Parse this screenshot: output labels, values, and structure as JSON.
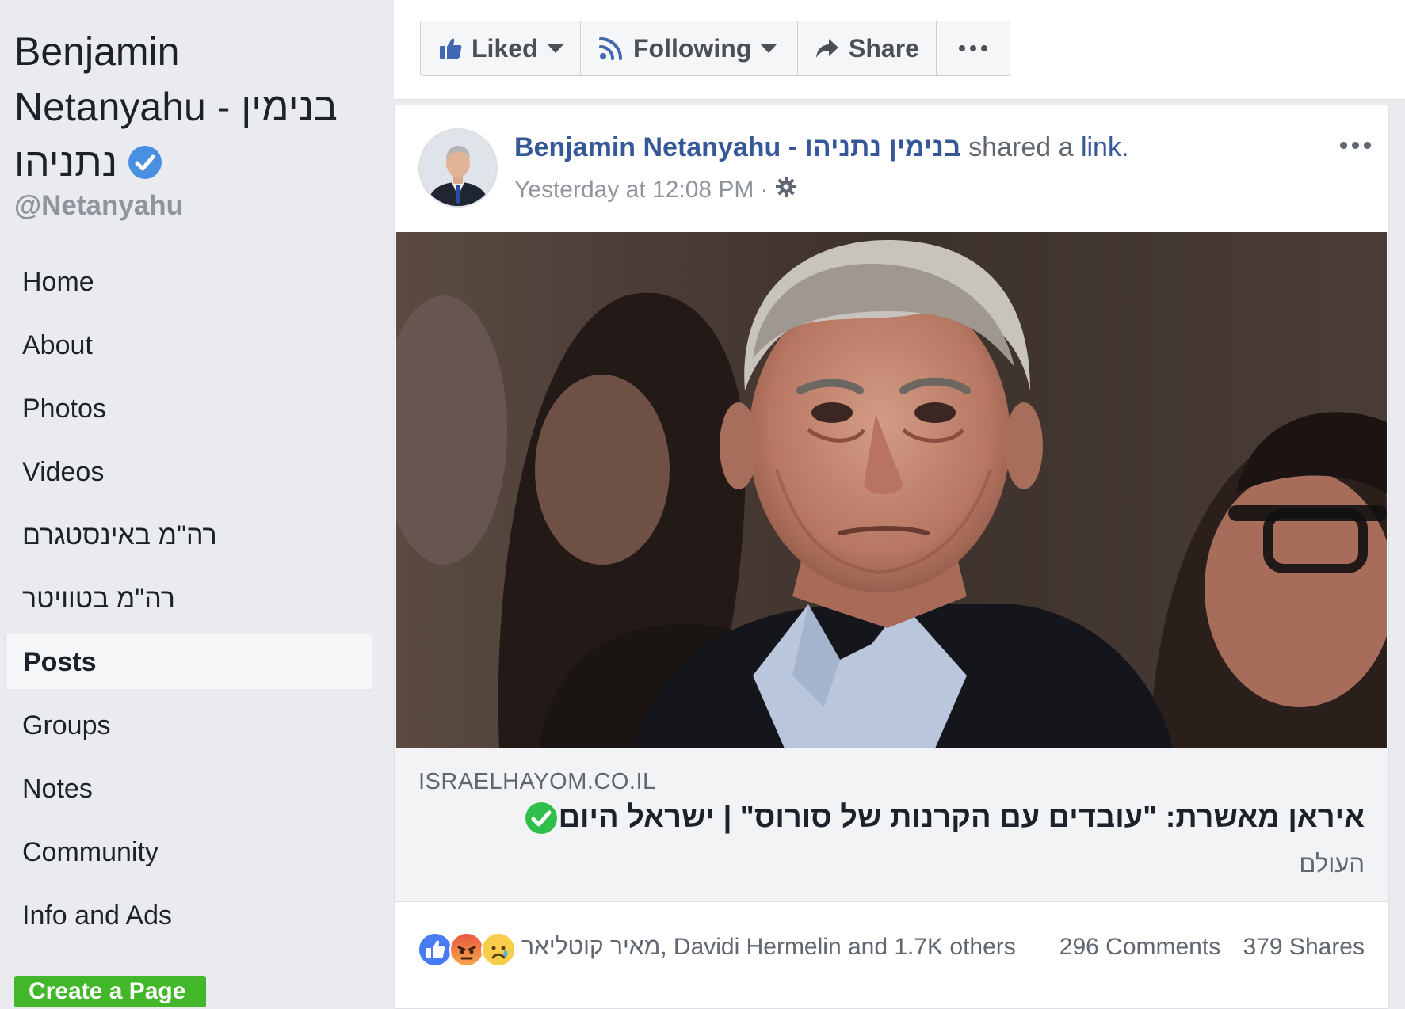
{
  "sidebar": {
    "page_name_line1": "Benjamin",
    "page_name_line2": "Netanyahu - בנימין",
    "page_name_line3": "נתניהו",
    "handle": "@Netanyahu",
    "nav_items": [
      {
        "label": "Home"
      },
      {
        "label": "About"
      },
      {
        "label": "Photos"
      },
      {
        "label": "Videos"
      },
      {
        "label": "רה\"מ באינסטגרם"
      },
      {
        "label": "רה\"מ בטוויטר"
      },
      {
        "label": "Posts",
        "active": true
      },
      {
        "label": "Groups"
      },
      {
        "label": "Notes"
      },
      {
        "label": "Community"
      },
      {
        "label": "Info and Ads"
      }
    ],
    "create_page_label": "Create a Page"
  },
  "actions": {
    "liked_label": "Liked",
    "following_label": "Following",
    "share_label": "Share"
  },
  "post": {
    "author": "Benjamin Netanyahu - בנימין נתניהו",
    "action_text": "shared a",
    "link_word": "link.",
    "timestamp": "Yesterday at 12:08 PM",
    "link": {
      "domain": "ISRAELHAYOM.CO.IL",
      "title": "איראן מאשרת: \"עובדים עם הקרנות של סורוס\" | ישראל היום",
      "subtitle": "העולם"
    },
    "reactions": {
      "icons": [
        "like-reaction-icon",
        "angry-reaction-icon",
        "sad-reaction-icon"
      ],
      "reactors": "מאיר קוטליאר, Davidi Hermelin and 1.7K others",
      "comments": "296 Comments",
      "shares": "379 Shares"
    }
  },
  "colors": {
    "facebook_blue": "#365899",
    "background": "#e9ebee",
    "verified_blue": "#4a90e2",
    "green_button": "#42b72a"
  }
}
